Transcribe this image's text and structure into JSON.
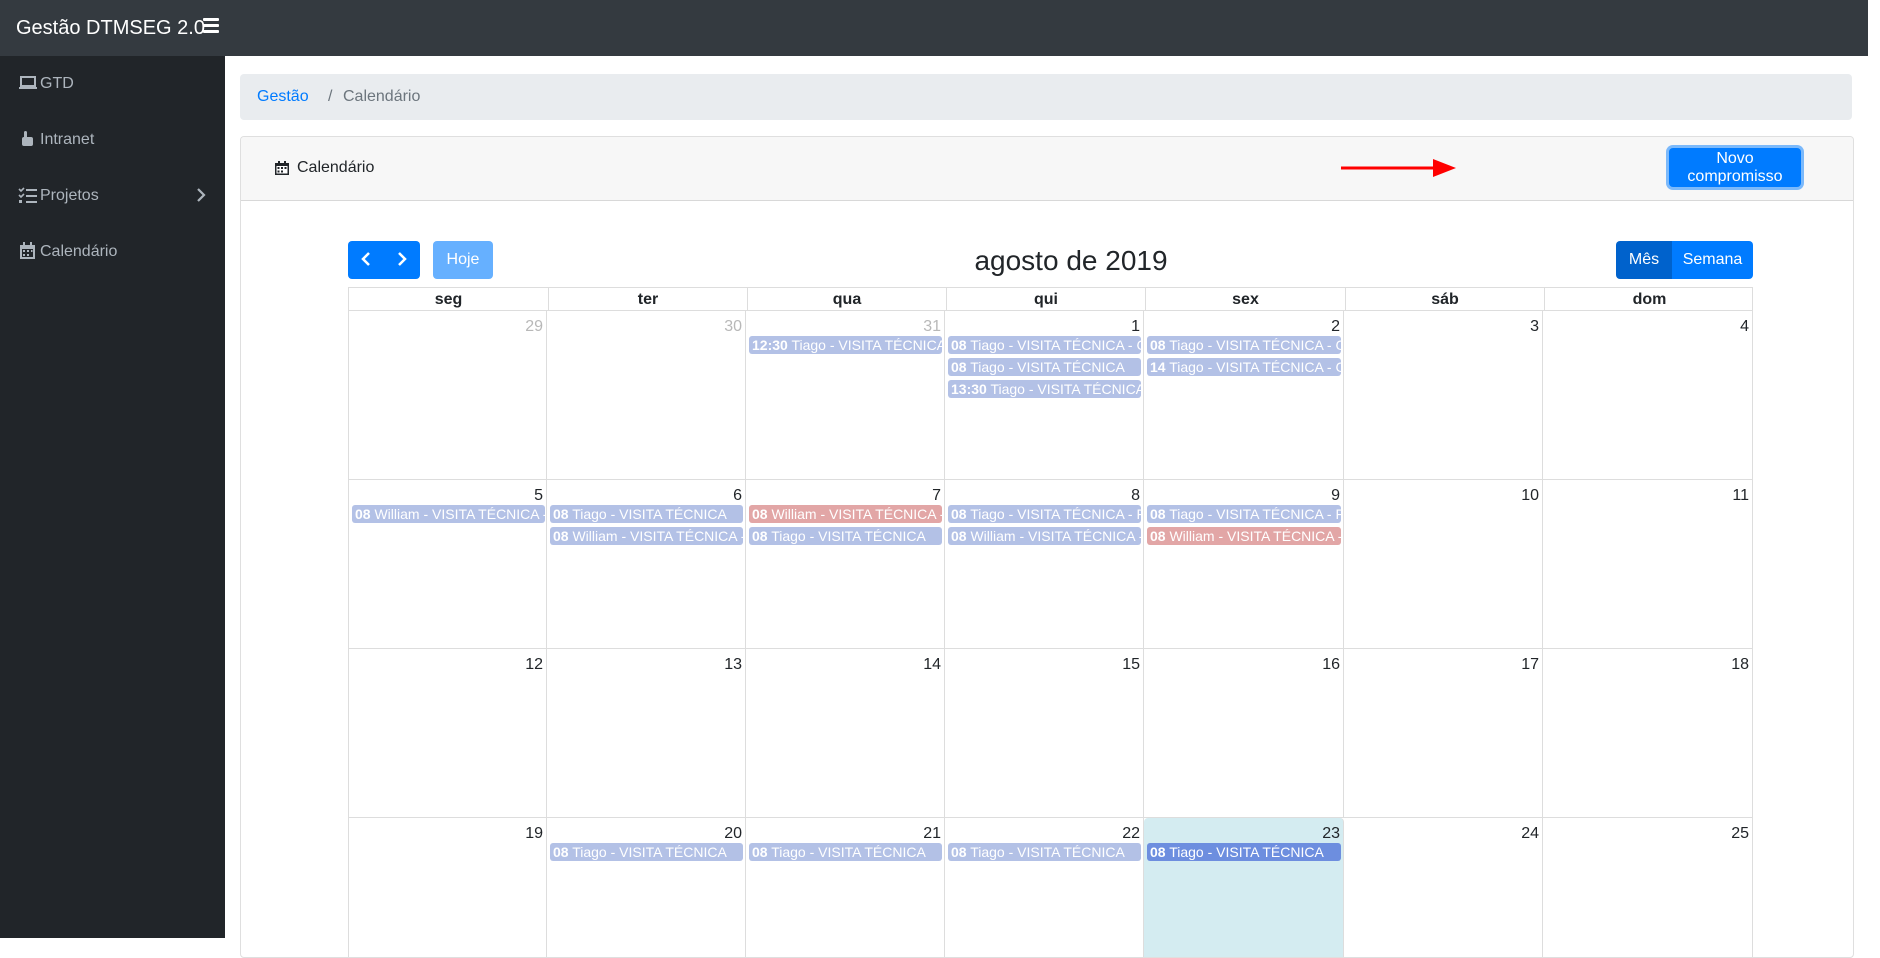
{
  "app": {
    "title": "Gestão DTMSEG 2.0",
    "menu_icon": "hamburger-icon"
  },
  "sidebar": {
    "items": [
      {
        "label": "GTD",
        "icon": "laptop-icon"
      },
      {
        "label": "Intranet",
        "icon": "hand-pointer-icon"
      },
      {
        "label": "Projetos",
        "icon": "tasks-icon",
        "has_submenu": true
      },
      {
        "label": "Calendário",
        "icon": "calendar-icon"
      }
    ]
  },
  "breadcrumb": {
    "home": "Gestão",
    "separator": "/",
    "current": "Calendário"
  },
  "card": {
    "title": "Calendário",
    "new_button": "Novo compromisso"
  },
  "calendar": {
    "title": "agosto de 2019",
    "today_label": "Hoje",
    "view_month": "Mês",
    "view_week": "Semana",
    "weekdays": [
      "seg",
      "ter",
      "qua",
      "qui",
      "sex",
      "sáb",
      "dom"
    ],
    "weeks": [
      [
        {
          "day": "29",
          "other": true,
          "events": []
        },
        {
          "day": "30",
          "other": true,
          "events": []
        },
        {
          "day": "31",
          "other": true,
          "events": [
            {
              "time": "12:30",
              "text": "Tiago - VISITA TÉCNICA",
              "color": "blue"
            }
          ]
        },
        {
          "day": "1",
          "events": [
            {
              "time": "08",
              "text": "Tiago - VISITA TÉCNICA - GO",
              "color": "blue"
            },
            {
              "time": "08",
              "text": "Tiago - VISITA TÉCNICA",
              "color": "blue"
            },
            {
              "time": "13:30",
              "text": "Tiago - VISITA TÉCNICA",
              "color": "blue"
            }
          ]
        },
        {
          "day": "2",
          "events": [
            {
              "time": "08",
              "text": "Tiago - VISITA TÉCNICA - GO",
              "color": "blue"
            },
            {
              "time": "14",
              "text": "Tiago - VISITA TÉCNICA - GO",
              "color": "blue"
            }
          ]
        },
        {
          "day": "3",
          "events": []
        },
        {
          "day": "4",
          "events": []
        }
      ],
      [
        {
          "day": "5",
          "events": [
            {
              "time": "08",
              "text": "William - VISITA TÉCNICA - G",
              "color": "blue"
            }
          ]
        },
        {
          "day": "6",
          "events": [
            {
              "time": "08",
              "text": "Tiago - VISITA TÉCNICA",
              "color": "blue"
            },
            {
              "time": "08",
              "text": "William - VISITA TÉCNICA - G",
              "color": "blue"
            }
          ]
        },
        {
          "day": "7",
          "events": [
            {
              "time": "08",
              "text": "William - VISITA TÉCNICA - G",
              "color": "red"
            },
            {
              "time": "08",
              "text": "Tiago - VISITA TÉCNICA",
              "color": "blue"
            }
          ]
        },
        {
          "day": "8",
          "events": [
            {
              "time": "08",
              "text": "Tiago - VISITA TÉCNICA - FR",
              "color": "blue"
            },
            {
              "time": "08",
              "text": "William - VISITA TÉCNICA - G",
              "color": "blue"
            }
          ]
        },
        {
          "day": "9",
          "events": [
            {
              "time": "08",
              "text": "Tiago - VISITA TÉCNICA - FR",
              "color": "blue"
            },
            {
              "time": "08",
              "text": "William - VISITA TÉCNICA - G",
              "color": "red"
            }
          ]
        },
        {
          "day": "10",
          "events": []
        },
        {
          "day": "11",
          "events": []
        }
      ],
      [
        {
          "day": "12",
          "events": []
        },
        {
          "day": "13",
          "events": []
        },
        {
          "day": "14",
          "events": []
        },
        {
          "day": "15",
          "events": []
        },
        {
          "day": "16",
          "events": []
        },
        {
          "day": "17",
          "events": []
        },
        {
          "day": "18",
          "events": []
        }
      ],
      [
        {
          "day": "19",
          "events": []
        },
        {
          "day": "20",
          "events": [
            {
              "time": "08",
              "text": "Tiago - VISITA TÉCNICA",
              "color": "blue"
            }
          ]
        },
        {
          "day": "21",
          "events": [
            {
              "time": "08",
              "text": "Tiago - VISITA TÉCNICA",
              "color": "blue"
            }
          ]
        },
        {
          "day": "22",
          "events": [
            {
              "time": "08",
              "text": "Tiago - VISITA TÉCNICA",
              "color": "blue"
            }
          ]
        },
        {
          "day": "23",
          "today": true,
          "events": [
            {
              "time": "08",
              "text": "Tiago - VISITA TÉCNICA",
              "color": "strong"
            }
          ]
        },
        {
          "day": "24",
          "events": []
        },
        {
          "day": "25",
          "events": []
        }
      ]
    ]
  }
}
